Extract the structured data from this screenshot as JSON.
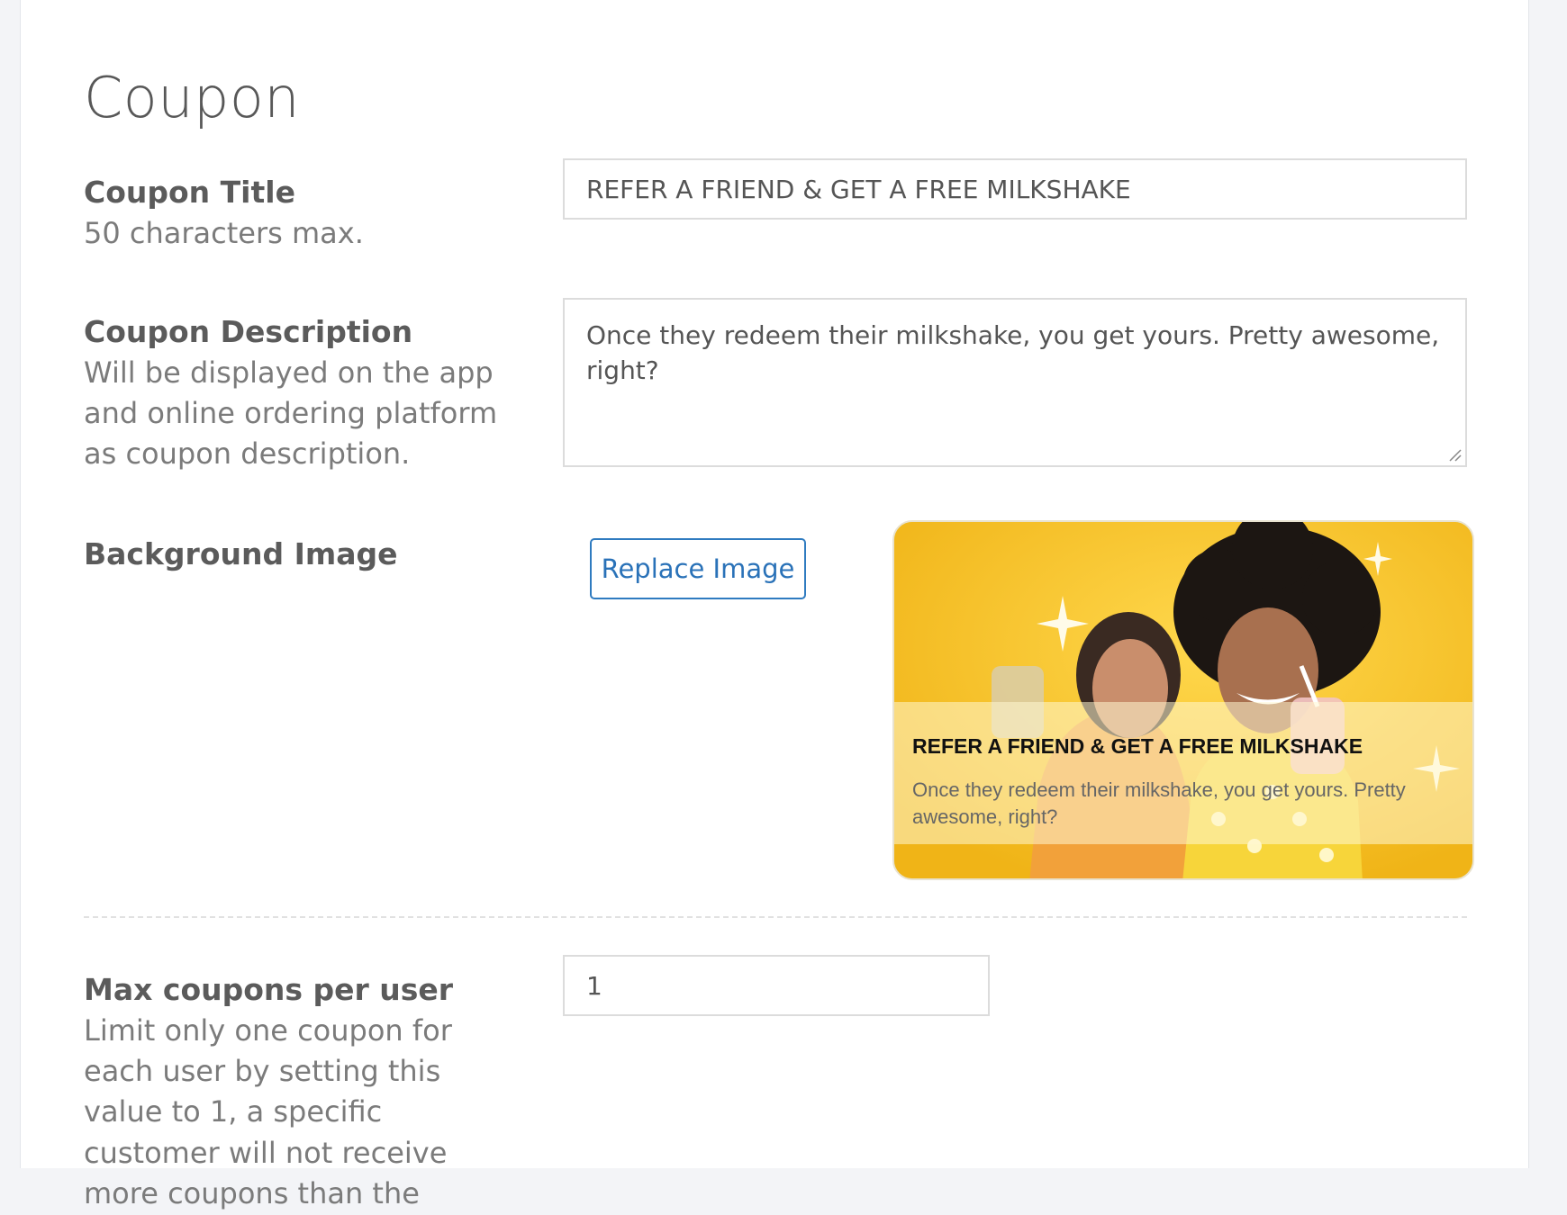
{
  "page": {
    "title": "Coupon"
  },
  "fields": {
    "coupon_title": {
      "label": "Coupon Title",
      "help": "50 characters max.",
      "value": "REFER A FRIEND & GET A FREE MILKSHAKE"
    },
    "coupon_description": {
      "label": "Coupon Description",
      "help": "Will be displayed on the app and online ordering platform as coupon description.",
      "value": "Once they redeem their milkshake, you get yours. Pretty awesome, right?"
    },
    "background_image": {
      "label": "Background Image",
      "replace_button": "Replace Image"
    },
    "max_coupons": {
      "label": "Max coupons per user",
      "help": "Limit only one coupon for each user by setting this value to 1, a specific customer will not receive more coupons than the",
      "value": "1"
    }
  },
  "preview": {
    "title": "REFER A FRIEND & GET A FREE MILKSHAKE",
    "description": "Once they redeem their milkshake, you get yours. Pretty awesome, right?"
  },
  "colors": {
    "accent": "#2f7bc0",
    "preview_background": "#f5c229"
  }
}
